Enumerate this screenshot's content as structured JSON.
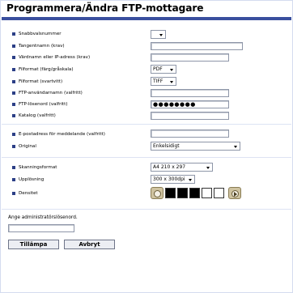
{
  "title": "Programmera/Ändra FTP-mottagare",
  "fields": {
    "snabbval": {
      "label": "Snabbvalsnummer",
      "value": ""
    },
    "tangentnamn": {
      "label": "Tangentnamn (krav)",
      "value": ""
    },
    "vardnamn": {
      "label": "Värdnamn eller IP-adress (krav)",
      "value": ""
    },
    "filformat_farg": {
      "label": "Filformat (färg/gråskala)",
      "value": "PDF"
    },
    "filformat_svartvitt": {
      "label": "Filformat (svartvitt)",
      "value": "TIFF"
    },
    "ftp_anvandarnamn": {
      "label": "FTP-användarnamn (valfritt)",
      "value": ""
    },
    "ftp_losenord": {
      "label": "FTP-lösenord (valfritt)",
      "value": "●●●●●●●●"
    },
    "katalog": {
      "label": "Katalog (valfritt)",
      "value": ""
    },
    "epost": {
      "label": "E-postadress för meddelande (valfritt)",
      "value": ""
    },
    "original": {
      "label": "Original",
      "value": "Enkelsidigt"
    },
    "skanningsformat": {
      "label": "Skanningsformat",
      "value": "A4 210 x 297"
    },
    "upplosning": {
      "label": "Upplösning",
      "value": "300 x 300dpi"
    },
    "densitet": {
      "label": "Densitet"
    }
  },
  "density_swatches": [
    "#000000",
    "#000000",
    "#000000",
    "#ffffff",
    "#ffffff"
  ],
  "admin": {
    "label": "Ange administratörslösenord.",
    "value": ""
  },
  "buttons": {
    "apply": "Tillämpa",
    "cancel": "Avbryt"
  },
  "colors": {
    "accent": "#3a4f9e",
    "bullet": "#2c3f86"
  }
}
